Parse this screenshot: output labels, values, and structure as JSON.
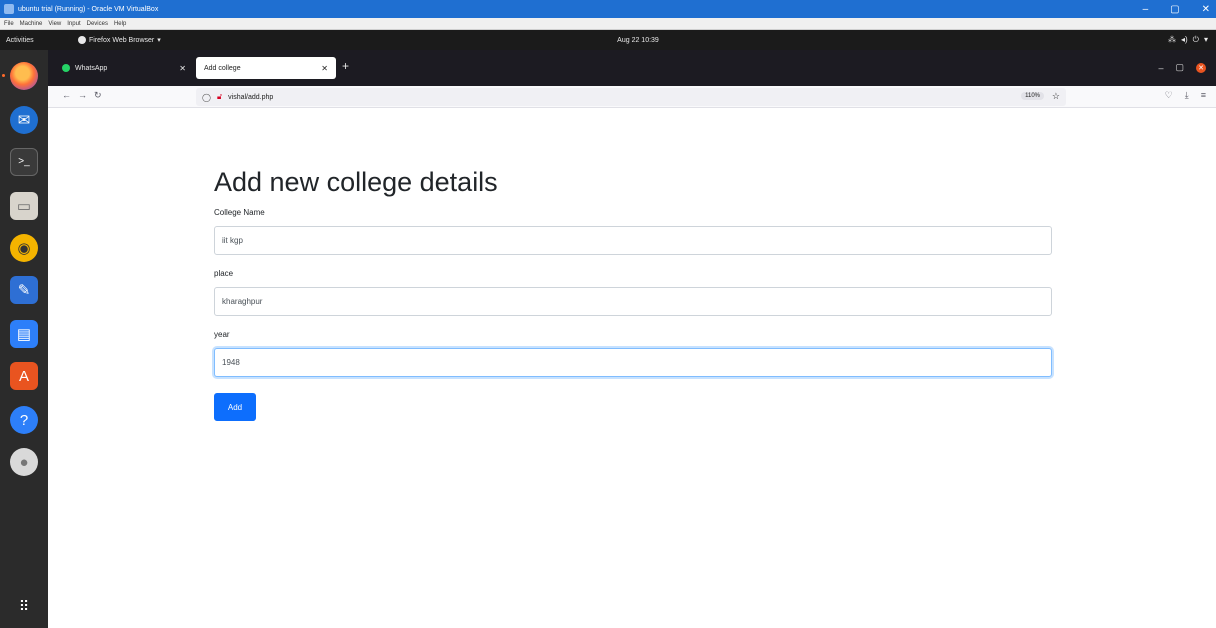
{
  "vbox": {
    "title": "ubuntu trial (Running) - Oracle VM VirtualBox",
    "menu": [
      "File",
      "Machine",
      "View",
      "Input",
      "Devices",
      "Help"
    ]
  },
  "gnome": {
    "activities": "Activities",
    "app_menu": "Firefox Web Browser",
    "clock": "Aug 22 10:39"
  },
  "dock": {
    "items": [
      "firefox-icon",
      "thunderbird-icon",
      "terminal-icon",
      "files-icon",
      "rhythmbox-icon",
      "text-editor-icon",
      "libreoffice-writer-icon",
      "software-center-icon",
      "help-icon",
      "dvd-icon",
      "show-apps-icon"
    ]
  },
  "firefox": {
    "tabs": [
      {
        "label": "WhatsApp"
      },
      {
        "label": "Add college"
      }
    ],
    "url": "vishal/add.php",
    "zoom": "110%"
  },
  "page": {
    "title": "Add new college details",
    "fields": [
      {
        "label": "College Name",
        "value": "iit kgp"
      },
      {
        "label": "place",
        "value": "kharaghpur"
      },
      {
        "label": "year",
        "value": "1948"
      }
    ],
    "submit_label": "Add"
  },
  "colors": {
    "primary": "#0d6efd",
    "dock": "#2b2b2b",
    "topbar": "#1b1b1b",
    "vbox_titlebar": "#1f6fd1"
  }
}
